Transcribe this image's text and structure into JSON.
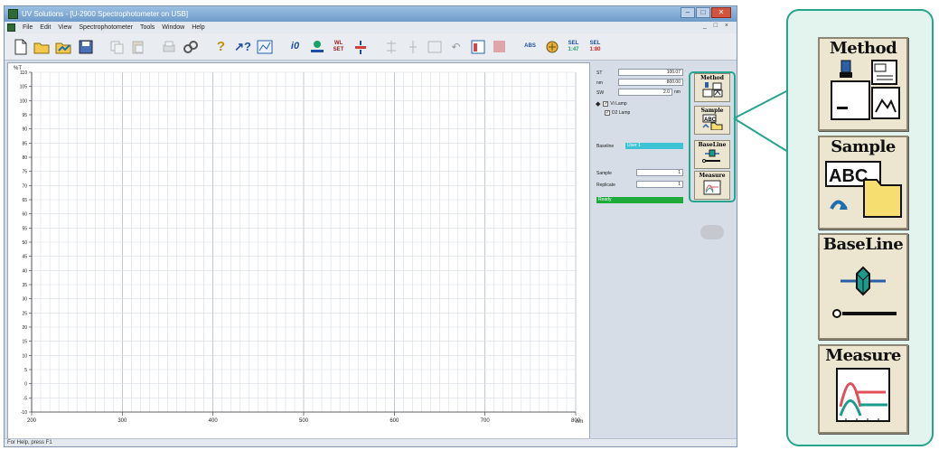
{
  "window": {
    "title": "UV Solutions - [U-2900 Spectrophotometer on USB]",
    "buttons": [
      "–",
      "□",
      "✕"
    ]
  },
  "menu": {
    "items": [
      "File",
      "Edit",
      "View",
      "Spectrophotometer",
      "Tools",
      "Window",
      "Help"
    ],
    "mdi_controls": "_ □ ×"
  },
  "toolbar": {
    "text_buttons": {
      "abs": "ABS",
      "sel1": "SEL",
      "sel1_sub": "1:47",
      "sel2": "SEL",
      "sel2_sub": "1:80"
    }
  },
  "chart_data": {
    "type": "line",
    "ylabel": "%T",
    "xlabel": "nm",
    "xlim": [
      200,
      800
    ],
    "ylim": [
      -10,
      110
    ],
    "x_ticks": [
      200,
      300,
      400,
      500,
      600,
      700,
      800
    ],
    "y_ticks": [
      110,
      105,
      100,
      95,
      90,
      85,
      80,
      75,
      70,
      65,
      60,
      55,
      50,
      45,
      40,
      35,
      30,
      25,
      20,
      15,
      10,
      5,
      0,
      -5,
      -10
    ],
    "grid": true,
    "series": []
  },
  "status": {
    "text": "For Help, press F1"
  },
  "info_panel": {
    "st_label": "ST",
    "st_value": "100.07",
    "nm_label": "nm",
    "nm_value": "800.00",
    "sw_label": "SW",
    "sw_value": "2.0",
    "sw_unit": "nm",
    "vi_lamp": "Vi Lamp",
    "d2_lamp": "D2 Lamp",
    "baseline_label": "Baseline",
    "baseline_value": "User 1",
    "sample_label": "Sample",
    "sample_value": "1",
    "replicate_label": "Replicate",
    "replicate_value": "1",
    "ready": "Ready"
  },
  "side_buttons": {
    "method": "Method",
    "sample": "Sample",
    "baseline": "BaseLine",
    "measure": "Measure"
  },
  "callout": {
    "method": "Method",
    "sample": "Sample",
    "baseline": "BaseLine",
    "measure": "Measure",
    "abc": "ABC"
  },
  "colors": {
    "accent": "#27a58c",
    "callout_bg": "#e3f4ee",
    "button_face": "#ece5cf",
    "baseline_bar": "#3cc4d4",
    "ready_bar": "#1faa3c",
    "measure_red": "#e0505a",
    "measure_teal": "#1a9b8c"
  }
}
